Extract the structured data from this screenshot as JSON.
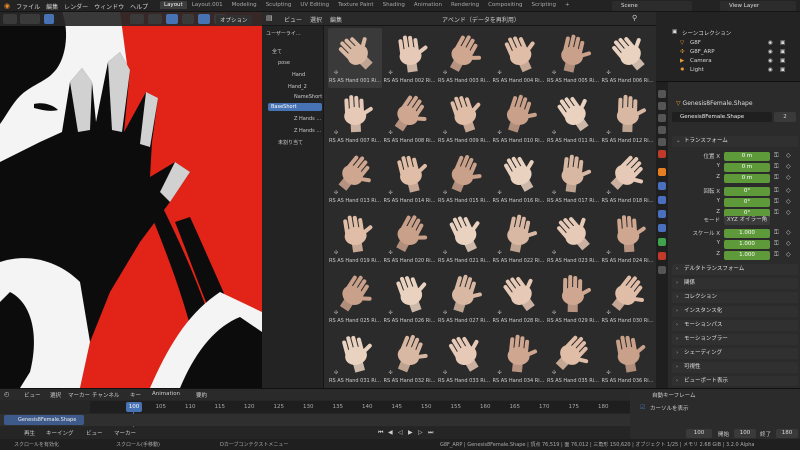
{
  "topbar": {
    "menus": [
      "ファイル",
      "編集",
      "レンダー",
      "ウィンドウ",
      "ヘルプ"
    ],
    "workspaces": [
      "Layout",
      "Layout.001",
      "Modeling",
      "Sculpting",
      "UV Editing",
      "Texture Paint",
      "Shading",
      "Animation",
      "Rendering",
      "Compositing",
      "Scripting"
    ],
    "active_workspace": "Layout",
    "add_tab": "+",
    "scene": "Scene",
    "view_layer": "View Layer"
  },
  "viewport": {
    "options_label": "オプション",
    "colors": {
      "background": "#e22418",
      "figure": "#0c0c0c",
      "highlight": "#ffffff"
    }
  },
  "file_browser": {
    "header_menus": [
      "ビュー",
      "選択",
      "編集"
    ],
    "append_label": "アペンド（データを再利用）",
    "side_title": "ユーザーライ...",
    "tree": [
      "全て",
      "pose",
      "Hand",
      "Hand_2",
      "NameShort",
      "BaseShort",
      "Z Hands ...",
      "Z Hands ...",
      "未割り当て"
    ],
    "selected_tree_item": "BaseShort",
    "items": [
      "RS AS Hand 001 Ri...",
      "RS AS Hand 002 Ri...",
      "RS AS Hand 003 Ri...",
      "RS AS Hand 004 Ri...",
      "RS AS Hand 005 Ri...",
      "RS AS Hand 006 Ri...",
      "RS AS Hand 007 Ri...",
      "RS AS Hand 008 Ri...",
      "RS AS Hand 009 Ri...",
      "RS AS Hand 010 Ri...",
      "RS AS Hand 011 Ri...",
      "RS AS Hand 012 Ri...",
      "RS AS Hand 013 Ri...",
      "RS AS Hand 014 Ri...",
      "RS AS Hand 015 Ri...",
      "RS AS Hand 016 Ri...",
      "RS AS Hand 017 Ri...",
      "RS AS Hand 018 Ri...",
      "RS AS Hand 019 Ri...",
      "RS AS Hand 020 Ri...",
      "RS AS Hand 021 Ri...",
      "RS AS Hand 022 Ri...",
      "RS AS Hand 023 Ri...",
      "RS AS Hand 024 Ri...",
      "RS AS Hand 025 Ri...",
      "RS AS Hand 026 Ri...",
      "RS AS Hand 027 Ri...",
      "RS AS Hand 028 Ri...",
      "RS AS Hand 029 Ri...",
      "RS AS Hand 030 Ri...",
      "RS AS Hand 031 Ri...",
      "RS AS Hand 032 Ri...",
      "RS AS Hand 033 Ri...",
      "RS AS Hand 034 Ri...",
      "RS AS Hand 035 Ri...",
      "RS AS Hand 036 Ri..."
    ]
  },
  "outliner": {
    "title": "シーンコレクション",
    "rows": [
      "G8F",
      "G8F_ARP",
      "Camera",
      "Light"
    ]
  },
  "properties": {
    "object_name": "Genesis8Female.Shape",
    "object_field": "Genesis8Female.Shape",
    "users": "2",
    "transform_title": "トランスフォーム",
    "location_label": "位置 X",
    "rotation_label": "回転 X",
    "scale_label": "スケール X",
    "axis_y": "Y",
    "axis_z": "Z",
    "location": [
      "0 m",
      "0 m",
      "0 m"
    ],
    "rotation": [
      "0°",
      "0°",
      "0°"
    ],
    "mode_label": "モード",
    "mode_value": "XYZ オイラー角",
    "scale": [
      "1.000",
      "1.000",
      "1.000"
    ],
    "panels": [
      "デルタトランスフォーム",
      "関係",
      "コレクション",
      "インスタンス化",
      "モーションパス",
      "モーションブラー",
      "シェーディング",
      "可視性",
      "ビューポート表示"
    ]
  },
  "timeline": {
    "menus": [
      "ビュー",
      "選択",
      "マーカー",
      "チャンネル",
      "キー",
      "Animation"
    ],
    "summary_label": "要約",
    "ticks": [
      "100",
      "105",
      "110",
      "115",
      "120",
      "125",
      "130",
      "135",
      "140",
      "145",
      "150",
      "155",
      "160",
      "165",
      "170",
      "175",
      "180"
    ],
    "current_frame": "100",
    "track_name": "Genesis8Female.Shape",
    "footer_menus": [
      "再生",
      "キーイング",
      "ビュー",
      "マーカー"
    ],
    "auto_key_label": "自動キーフレーム",
    "cursor_label": "カーソルを表示",
    "frame_current": "100",
    "start_label": "開始",
    "start": "100",
    "end_label": "終了",
    "end": "180"
  },
  "statusbar": {
    "left": [
      "スクロールを有効化",
      "スクロール(手移動)",
      "Dカーブコンテクストメニュー"
    ],
    "right": "G8F_ARP | Genesis8Female.Shape | 頂点 76,519 | 面 76,012 | 三角形 150,620 | オブジェクト 1/25 | メモリ 2.68 GiB | 3.2.0 Alpha"
  }
}
